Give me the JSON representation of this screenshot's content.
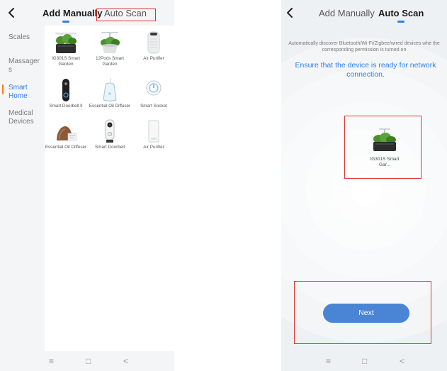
{
  "left": {
    "tabs": {
      "add_manually": "Add Manually",
      "auto_scan": "Auto Scan"
    },
    "sidebar": {
      "items": [
        {
          "label": "Scales"
        },
        {
          "label": "Massager s"
        },
        {
          "label": "Smart Home"
        },
        {
          "label": "Medical Devices"
        }
      ],
      "selected": "Smart Home"
    },
    "devices": [
      {
        "label": "IG301S Smart Garden",
        "icon": "smart-garden-icon"
      },
      {
        "label": "12Pods Smart Garden",
        "icon": "smart-garden-icon"
      },
      {
        "label": "Air Purifier",
        "icon": "air-purifier-icon"
      },
      {
        "label": "Smart Doorbell II",
        "icon": "doorbell-icon"
      },
      {
        "label": "Essential Oil Diffuser",
        "icon": "diffuser-icon"
      },
      {
        "label": "Smart Socket",
        "icon": "socket-icon"
      },
      {
        "label": "Essential Oil Diffuser",
        "icon": "wood-diffuser-icon"
      },
      {
        "label": "Smart Doorbell",
        "icon": "doorbell-camera-icon"
      },
      {
        "label": "Air Purifier",
        "icon": "air-purifier-box-icon"
      }
    ],
    "nav": {
      "menu": "≡",
      "home": "□",
      "back": "<"
    }
  },
  "right": {
    "tabs": {
      "add_manually": "Add Manually",
      "auto_scan": "Auto Scan"
    },
    "hint": "Automatically discover Bluetooth/Wi-Fi/Zigbee/wired devices whe the corresponding permission is turned on",
    "ready_text": "Ensure that the device is ready for network connection.",
    "found_device": {
      "label": "IG301S Smart Gar...",
      "icon": "smart-garden-icon"
    },
    "next_button": "Next",
    "nav": {
      "menu": "≡",
      "home": "□",
      "back": "<"
    }
  },
  "colors": {
    "accent": "#2f80ed",
    "highlight": "#d9362b",
    "button": "#4a84d4",
    "sidebar_marker": "#ff7a1a"
  }
}
